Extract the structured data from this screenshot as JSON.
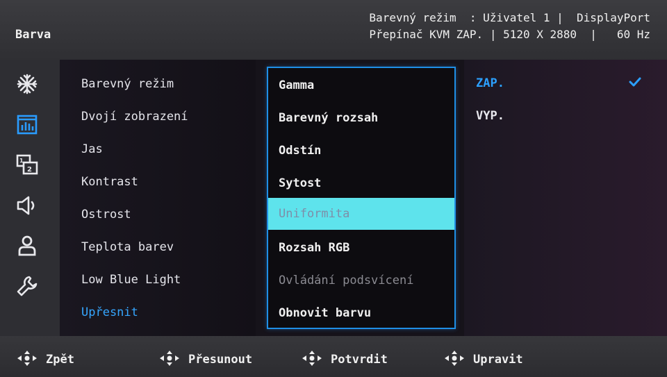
{
  "header": {
    "title": "Barva",
    "status_line1": "Barevný režim  : Uživatel 1 |  DisplayPort",
    "status_line2": "Přepínač KVM ZAP. | 5120 X 2880  |   60 Hz"
  },
  "sidebar": {
    "icons": [
      "snowflake-icon",
      "color-bars-icon",
      "picture-in-picture-icon",
      "speaker-icon",
      "person-icon",
      "wrench-icon"
    ],
    "active_icon": "color-bars-icon",
    "accent_color": "#2a9cff"
  },
  "menu": {
    "items": [
      "Barevný režim",
      "Dvojí zobrazení",
      "Jas",
      "Kontrast",
      "Ostrost",
      "Teplota barev",
      "Low Blue Light",
      "Upřesnit"
    ],
    "active": "Upřesnit"
  },
  "submenu": {
    "items": [
      "Gamma",
      "Barevný rozsah",
      "Odstín",
      "Sytost",
      "Uniformita",
      "Rozsah RGB",
      "Ovládání podsvícení",
      "Obnovit barvu"
    ],
    "highlighted": "Uniformita",
    "disabled": [
      "Ovládání podsvícení"
    ],
    "highlight_color": "#5ee3ec"
  },
  "options": {
    "items": [
      "ZAP.",
      "VYP."
    ],
    "selected": "ZAP."
  },
  "footer": {
    "buttons": [
      "Zpět",
      "Přesunout",
      "Potvrdit",
      "Upravit"
    ]
  }
}
